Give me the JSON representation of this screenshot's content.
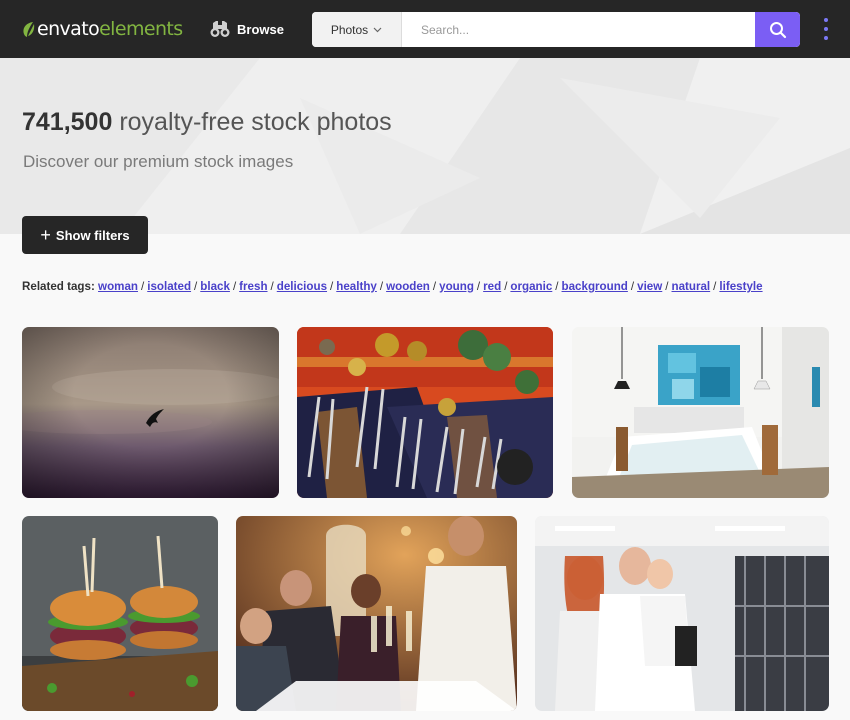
{
  "header": {
    "logo_part1": "envato",
    "logo_part2": "elements",
    "browse_label": "Browse",
    "search": {
      "category": "Photos",
      "placeholder": "Search..."
    },
    "icons": [
      "leaf-icon",
      "binoculars-icon",
      "chevron-down-icon",
      "search-icon",
      "more-vertical-icon"
    ]
  },
  "hero": {
    "count": "741,500",
    "title_rest": "royalty-free stock photos",
    "subtitle": "Discover our premium stock images"
  },
  "filters_button": "Show filters",
  "related_tags": {
    "label": "Related tags:",
    "tags": [
      "woman",
      "isolated",
      "black",
      "fresh",
      "delicious",
      "healthy",
      "wooden",
      "young",
      "red",
      "organic",
      "background",
      "view",
      "natural",
      "lifestyle"
    ]
  },
  "photos": [
    {
      "subject": "bird-in-cloudy-sky"
    },
    {
      "subject": "tuning-forks-on-colorful-cloth"
    },
    {
      "subject": "bedroom-interior"
    },
    {
      "subject": "veggie-burgers"
    },
    {
      "subject": "people-toasting-at-dinner"
    },
    {
      "subject": "family-at-gym"
    }
  ],
  "colors": {
    "header_bg": "#262626",
    "brand_green": "#82b541",
    "accent_purple": "#7b5ef4",
    "tag_link": "#4a41c9"
  }
}
